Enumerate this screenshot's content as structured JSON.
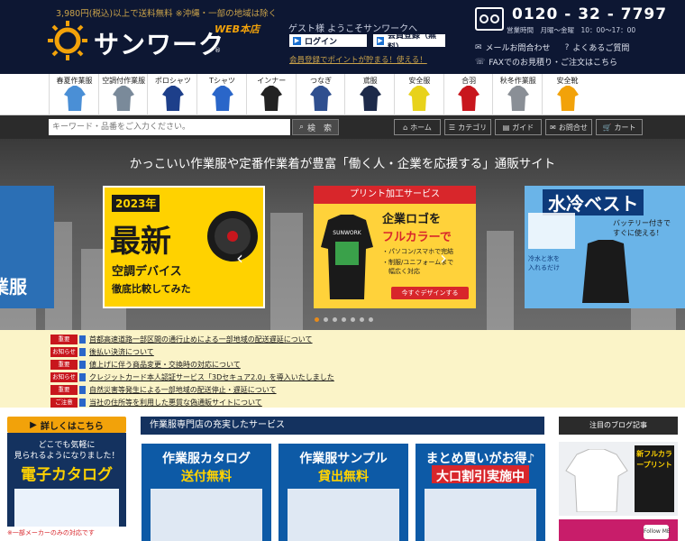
{
  "header": {
    "promo": "3,980円(税込)以上で送料無料 ※沖縄・一部の地域は除く",
    "brand": "サンワーク",
    "brand_web": "WEB本店",
    "brand_reg": "®",
    "welcome": "ゲスト様 ようこそサンワークへ",
    "login_label": "ログイン",
    "register_label": "会員登録（無料）",
    "member_note": "会員登録でポイントが貯まる！使える！",
    "phone": "0120 - 32 - 7797",
    "hours": "営業時間　月曜〜金曜　10：00〜17：00",
    "links": {
      "mail": "メールお問合わせ",
      "faq": "よくあるご質問",
      "fax": "FAXでのお見積り・ご注文はこちら"
    }
  },
  "categories": [
    {
      "label": "春夏作業服",
      "color": "#4a8fd6"
    },
    {
      "label": "空調付作業服",
      "color": "#7a8a9a"
    },
    {
      "label": "ポロシャツ",
      "color": "#1d3f8a"
    },
    {
      "label": "Tシャツ",
      "color": "#2a66c9"
    },
    {
      "label": "インナー",
      "color": "#222222"
    },
    {
      "label": "つなぎ",
      "color": "#2f4f8f"
    },
    {
      "label": "鳶服",
      "color": "#1d2a4a"
    },
    {
      "label": "安全服",
      "color": "#e8d21a"
    },
    {
      "label": "合羽",
      "color": "#c8161d"
    },
    {
      "label": "秋冬作業服",
      "color": "#8a8f96"
    },
    {
      "label": "安全靴",
      "color": "#f2a20a"
    }
  ],
  "search": {
    "placeholder": "キーワード・品番をご入力ください。",
    "button": "検　索"
  },
  "nav_buttons": [
    {
      "label": "ホーム",
      "icon": "home-icon",
      "glyph": "⌂"
    },
    {
      "label": "カテゴリ",
      "icon": "list-icon",
      "glyph": "☰"
    },
    {
      "label": "ガイド",
      "icon": "guide-icon",
      "glyph": "▤"
    },
    {
      "label": "お問合せ",
      "icon": "mail-icon",
      "glyph": "✉"
    },
    {
      "label": "カート",
      "icon": "cart-icon",
      "glyph": "🛒"
    }
  ],
  "hero": {
    "tagline": "かっこいい作業服や定番作業着が豊富「働く人・企業を応援する」通販サイト",
    "slide1_text": "業服",
    "slide2": {
      "year": "2023年",
      "big": "最新",
      "sub1": "空調デバイス",
      "sub2": "徹底比較してみた"
    },
    "slide3": {
      "head": "プリント加工サービス",
      "l1": "企業ロゴを",
      "l2": "フルカラーで",
      "bullets": [
        "・パソコン/スマホで完結",
        "・制服/ユニフォームまで",
        "　幅広く対応"
      ],
      "cta": "今すぐデザインする",
      "jacket_text": "SUNWORK"
    },
    "slide4": {
      "title": "水冷ベスト",
      "sub": "バッテリー付きですぐに使える！",
      "side": "冷水と氷を入れるだけ"
    },
    "dots_total": 7,
    "dots_active": 0,
    "arrow_prev": "‹",
    "arrow_next": "›"
  },
  "news": [
    {
      "badge": "重要",
      "type": "important",
      "text": "首都高速道路一部区間の通行止めによる一部地域の配送遅延について"
    },
    {
      "badge": "お知らせ",
      "type": "notice",
      "text": "後払い決済について"
    },
    {
      "badge": "重要",
      "type": "important",
      "text": "値上げに伴う商品変更・交換時の対応について"
    },
    {
      "badge": "お知らせ",
      "type": "notice",
      "text": "クレジットカード本人認証サービス「3Dセキュア2.0」を導入いたしました"
    },
    {
      "badge": "重要",
      "type": "important",
      "text": "自然災害等発生による一部地域の配送停止・遅延について"
    },
    {
      "badge": "ご注意",
      "type": "caution",
      "text": "当社の住所等を利用した悪質な偽通販サイトについて"
    }
  ],
  "ecatalog": {
    "button": "詳しくはこちら",
    "l1": "どこでも気軽に",
    "l2": "見られるようになりました！",
    "l3": "電子カタログ",
    "note": "※一部メーカーのみの対応です"
  },
  "services": {
    "header": "作業服専門店の充実したサービス",
    "cards": [
      {
        "t1": "作業服カタログ",
        "t2": "送付無料"
      },
      {
        "t1": "作業服サンプル",
        "t2": "貸出無料"
      },
      {
        "t1": "まとめ買いがお得♪",
        "t2": "大口割引実施中"
      }
    ]
  },
  "blog": {
    "header": "注目のブログ記事",
    "panel": "新フルカラープリント",
    "follow": "Follow ME"
  }
}
